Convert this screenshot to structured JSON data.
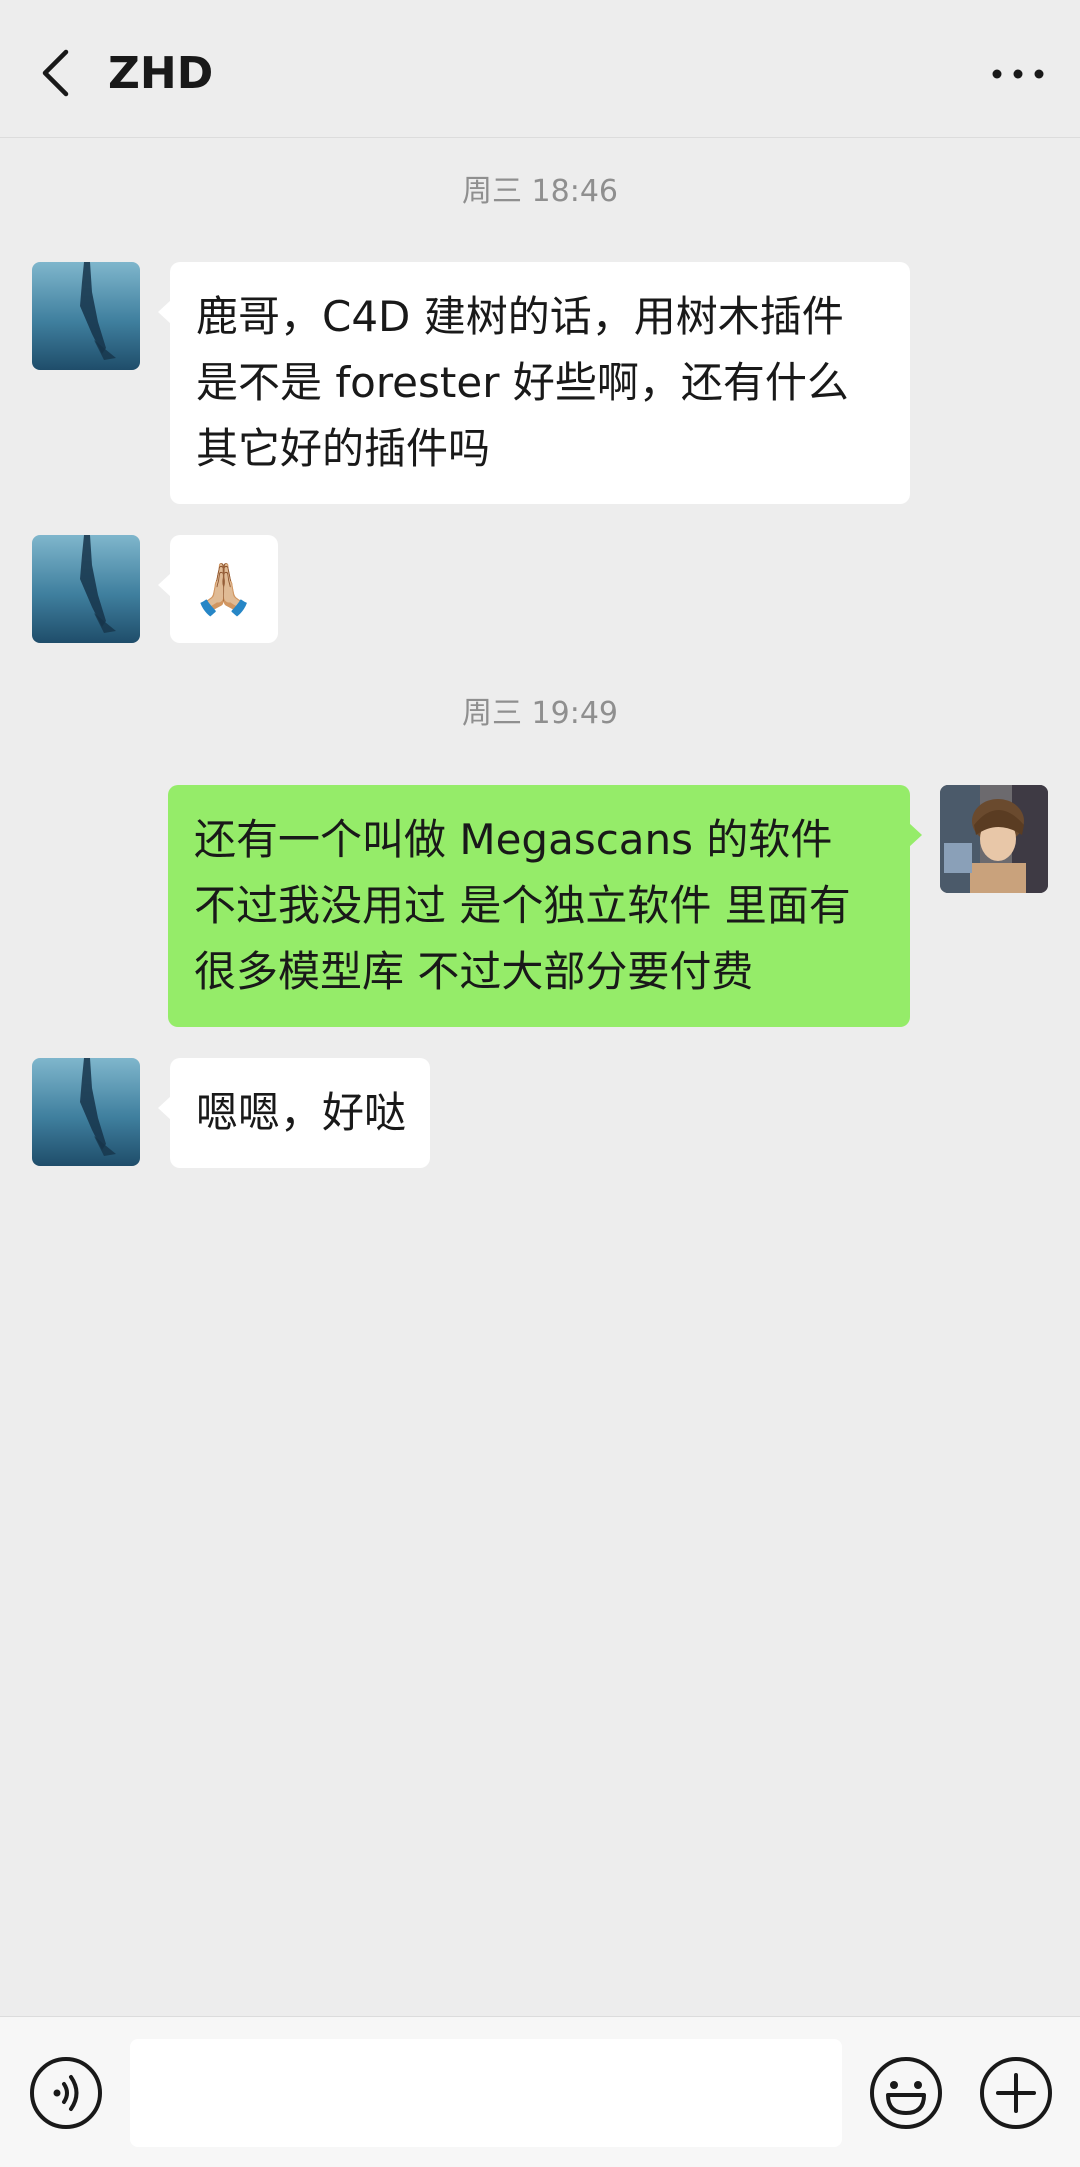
{
  "header": {
    "title": "ZHD",
    "back_icon": "chevron-left-icon",
    "more_icon": "more-dots-icon"
  },
  "messages": [
    {
      "type": "timestamp",
      "text": "周三 18:46"
    },
    {
      "type": "message",
      "side": "left",
      "sender": "contact",
      "lines": [
        "鹿哥，C4D 建树的话，用树木插件",
        "是不是 forester 好些啊，还有什么",
        "其它好的插件吗"
      ]
    },
    {
      "type": "message",
      "side": "left",
      "sender": "contact",
      "lines": [
        "🙏🏼"
      ]
    },
    {
      "type": "timestamp",
      "text": "周三 19:49"
    },
    {
      "type": "message",
      "side": "right",
      "sender": "me",
      "lines": [
        "还有一个叫做 Megascans 的软件",
        "不过我没用过 是个独立软件 里面有",
        "很多模型库 不过大部分要付费"
      ]
    },
    {
      "type": "message",
      "side": "left",
      "sender": "contact",
      "lines": [
        "嗯嗯，好哒"
      ]
    }
  ],
  "input": {
    "value": "",
    "voice_icon": "voice-icon",
    "emoji_icon": "emoji-icon",
    "plus_icon": "plus-icon"
  },
  "colors": {
    "background": "#ededed",
    "bubble_left": "#ffffff",
    "bubble_right": "#95ec69",
    "timestamp": "#8f8f8f"
  }
}
